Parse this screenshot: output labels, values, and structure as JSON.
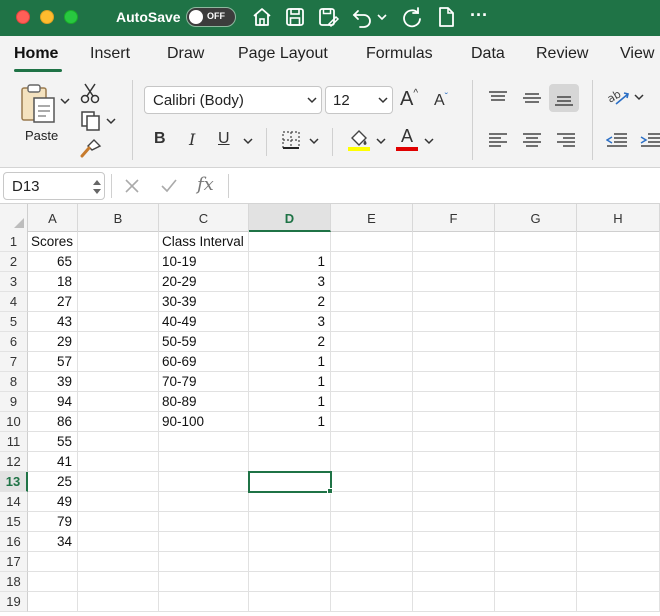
{
  "titlebar": {
    "autosave_label": "AutoSave",
    "autosave_state": "OFF",
    "more_label": "···"
  },
  "tabs": [
    {
      "label": "Home",
      "active": true
    },
    {
      "label": "Insert"
    },
    {
      "label": "Draw"
    },
    {
      "label": "Page Layout"
    },
    {
      "label": "Formulas"
    },
    {
      "label": "Data"
    },
    {
      "label": "Review"
    },
    {
      "label": "View"
    }
  ],
  "ribbon": {
    "paste_label": "Paste",
    "font_name": "Calibri (Body)",
    "font_size": "12",
    "bold": "B",
    "italic": "I",
    "underline": "U",
    "font_color_letter": "A",
    "grow_font": "A",
    "shrink_font": "A",
    "highlight_color": "#ffff00",
    "font_color": "#e00000"
  },
  "formula_bar": {
    "name_box": "D13",
    "fx": "fx",
    "formula": ""
  },
  "sheet": {
    "columns": [
      "A",
      "B",
      "C",
      "D",
      "E",
      "F",
      "G",
      "H"
    ],
    "rows": [
      "1",
      "2",
      "3",
      "4",
      "5",
      "6",
      "7",
      "8",
      "9",
      "10",
      "11",
      "12",
      "13",
      "14",
      "15",
      "16",
      "17",
      "18",
      "19"
    ],
    "selected_cell": "D13",
    "column_a": [
      "Scores",
      "65",
      "18",
      "27",
      "43",
      "29",
      "57",
      "39",
      "94",
      "86",
      "55",
      "41",
      "25",
      "49",
      "79",
      "34"
    ],
    "column_c": [
      "Class Interval",
      "10-19",
      "20-29",
      "30-39",
      "40-49",
      "50-59",
      "60-69",
      "70-79",
      "80-89",
      "90-100"
    ],
    "column_d": [
      "",
      "1",
      "3",
      "2",
      "3",
      "2",
      "1",
      "1",
      "1",
      "1"
    ]
  },
  "colors": {
    "accent": "#1f7346"
  }
}
